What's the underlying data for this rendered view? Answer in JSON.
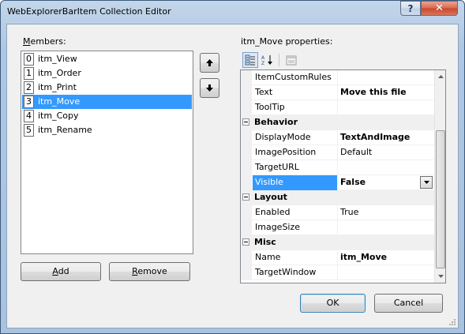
{
  "window": {
    "title": "WebExplorerBarItem Collection Editor",
    "help_glyph": "?",
    "close_glyph": "✕"
  },
  "members": {
    "label_prefix": "",
    "label_accel": "M",
    "label_rest": "embers:",
    "items": [
      {
        "index": "0",
        "name": "itm_View"
      },
      {
        "index": "1",
        "name": "itm_Order"
      },
      {
        "index": "2",
        "name": "itm_Print"
      },
      {
        "index": "3",
        "name": "itm_Move"
      },
      {
        "index": "4",
        "name": "itm_Copy"
      },
      {
        "index": "5",
        "name": "itm_Rename"
      }
    ],
    "selected_index": 3
  },
  "buttons": {
    "add_accel": "A",
    "add_rest": "dd",
    "remove_accel": "R",
    "remove_rest": "emove",
    "ok": "OK",
    "cancel": "Cancel",
    "move_up_icon": "arrow-up-icon",
    "move_down_icon": "arrow-down-icon"
  },
  "properties": {
    "label": "itm_Move properties:",
    "toolbar": [
      "categorized-icon",
      "alphabetical-icon",
      "property-pages-icon"
    ],
    "rows": [
      {
        "type": "prop",
        "name": "ItemCustomRules",
        "value": "",
        "bold": false
      },
      {
        "type": "prop",
        "name": "Text",
        "value": "Move this file",
        "bold": true
      },
      {
        "type": "prop",
        "name": "ToolTip",
        "value": "",
        "bold": false
      },
      {
        "type": "category",
        "name": "Behavior"
      },
      {
        "type": "prop",
        "name": "DisplayMode",
        "value": "TextAndImage",
        "bold": true
      },
      {
        "type": "prop",
        "name": "ImagePosition",
        "value": "Default",
        "bold": false
      },
      {
        "type": "prop",
        "name": "TargetURL",
        "value": "",
        "bold": false
      },
      {
        "type": "prop",
        "name": "Visible",
        "value": "False",
        "bold": true,
        "selected": true,
        "dropdown": true
      },
      {
        "type": "category",
        "name": "Layout"
      },
      {
        "type": "prop",
        "name": "Enabled",
        "value": "True",
        "bold": false
      },
      {
        "type": "prop",
        "name": "ImageSize",
        "value": "",
        "bold": false
      },
      {
        "type": "category",
        "name": "Misc"
      },
      {
        "type": "prop",
        "name": "Name",
        "value": "itm_Move",
        "bold": true
      },
      {
        "type": "prop",
        "name": "TargetWindow",
        "value": "",
        "bold": false
      }
    ]
  },
  "colors": {
    "selection": "#3399ff",
    "close_button": "#c7472c",
    "dialog_bg": "#f0f0f0"
  }
}
